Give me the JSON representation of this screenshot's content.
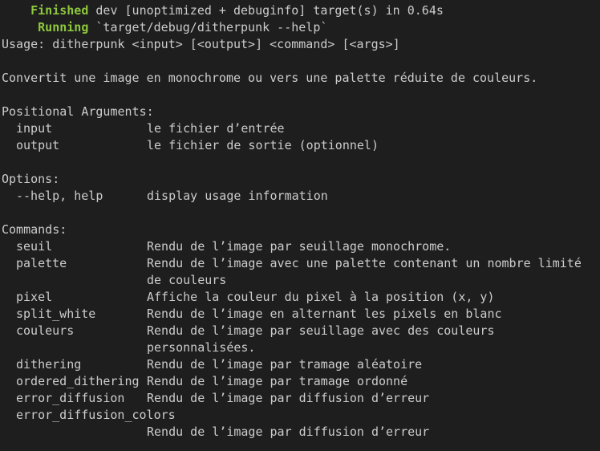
{
  "build": {
    "finished_label": "Finished",
    "finished_text": " dev [unoptimized + debuginfo] target(s) in 0.64s",
    "running_label": "Running",
    "running_text": " `target/debug/ditherpunk --help`"
  },
  "usage": "Usage: ditherpunk <input> [<output>] <command> [<args>]",
  "description": "Convertit une image en monochrome ou vers une palette réduite de couleurs.",
  "positional": {
    "heading": "Positional Arguments:",
    "items": [
      {
        "name": "input",
        "desc": "le fichier d’entrée"
      },
      {
        "name": "output",
        "desc": "le fichier de sortie (optionnel)"
      }
    ]
  },
  "options": {
    "heading": "Options:",
    "items": [
      {
        "name": "--help, help",
        "desc": "display usage information"
      }
    ]
  },
  "commands": {
    "heading": "Commands:",
    "items": [
      {
        "name": "seuil",
        "desc": "Rendu de l’image par seuillage monochrome."
      },
      {
        "name": "palette",
        "desc": "Rendu de l’image avec une palette contenant un nombre limité",
        "desc2": "de couleurs"
      },
      {
        "name": "pixel",
        "desc": "Affiche la couleur du pixel à la position (x, y)"
      },
      {
        "name": "split_white",
        "desc": "Rendu de l’image en alternant les pixels en blanc"
      },
      {
        "name": "couleurs",
        "desc": "Rendu de l’image par seuillage avec des couleurs",
        "desc2": "personnalisées."
      },
      {
        "name": "dithering",
        "desc": "Rendu de l’image par tramage aléatoire"
      },
      {
        "name": "ordered_dithering",
        "desc": "Rendu de l’image par tramage ordonné"
      },
      {
        "name": "error_diffusion",
        "desc": "Rendu de l’image par diffusion d’erreur"
      },
      {
        "name": "error_diffusion_colors",
        "desc2": "Rendu de l’image par diffusion d’erreur"
      }
    ]
  },
  "colors": {
    "background": "#1e1e1e",
    "text": "#cccccc",
    "accent_green": "#8ec73d"
  }
}
